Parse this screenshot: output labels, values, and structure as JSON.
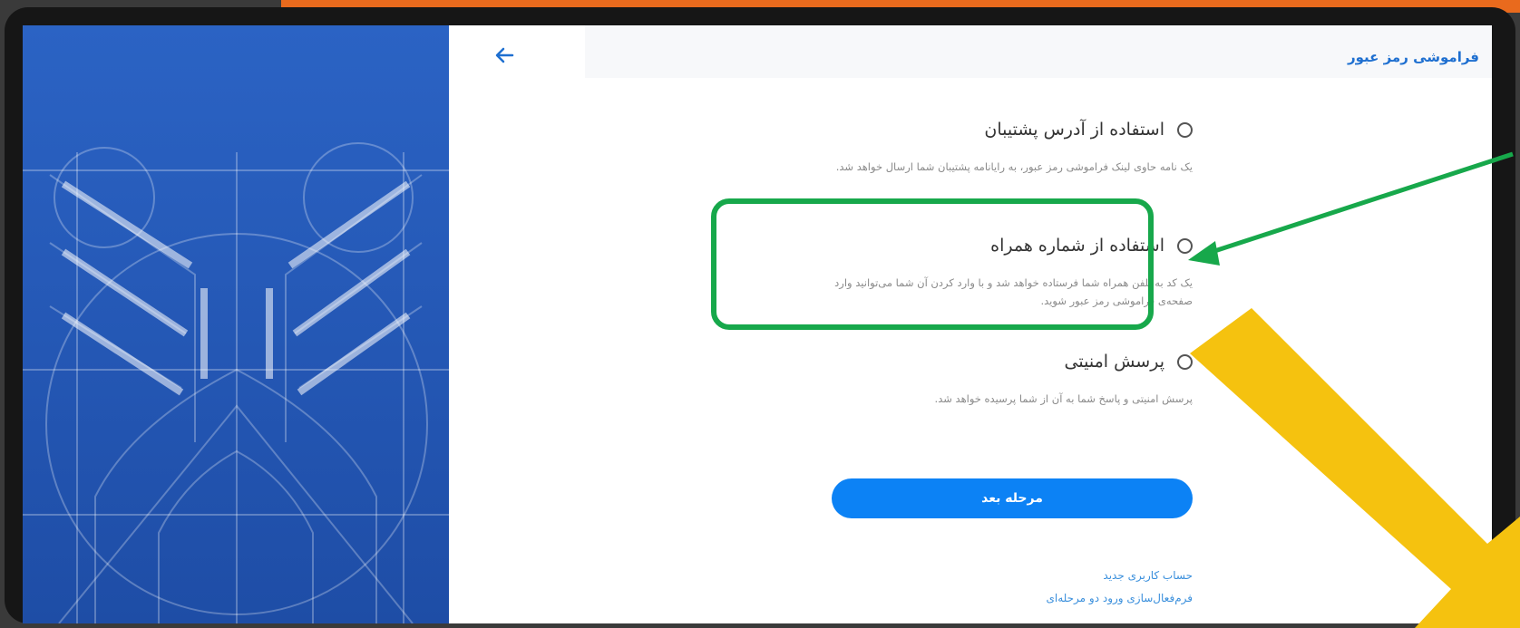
{
  "header": {
    "title": "فراموشی رمز عبور",
    "back_icon": "arrow-left-icon"
  },
  "options": [
    {
      "label": "استفاده از آدرس پشتیبان",
      "description": "یک نامه حاوی لینک فراموشی رمز عبور، به رایانامه پشتیبان شما ارسال خواهد شد."
    },
    {
      "label": "استفاده از شماره همراه",
      "description": "یک کد به تلفن همراه شما فرستاده خواهد شد و با وارد کردن آن شما می‌توانید وارد صفحه‌ی فراموشی رمز عبور شوید."
    },
    {
      "label": "پرسش امنیتی",
      "description": "پرسش امنیتی و پاسخ شما به آن از شما پرسیده خواهد شد."
    }
  ],
  "next_button": {
    "label": "مرحله بعد",
    "color": "#0c82f5"
  },
  "links": {
    "new_account": "حساب کاربری جدید",
    "two_step": "فرم‌فعال‌سازی ورود دو مرحله‌ای"
  },
  "colors": {
    "sidebar": "#2457b4",
    "highlight": "#17a84b",
    "annotation_arrow": "#f5c20f",
    "top_bar": "#e96a1d"
  }
}
